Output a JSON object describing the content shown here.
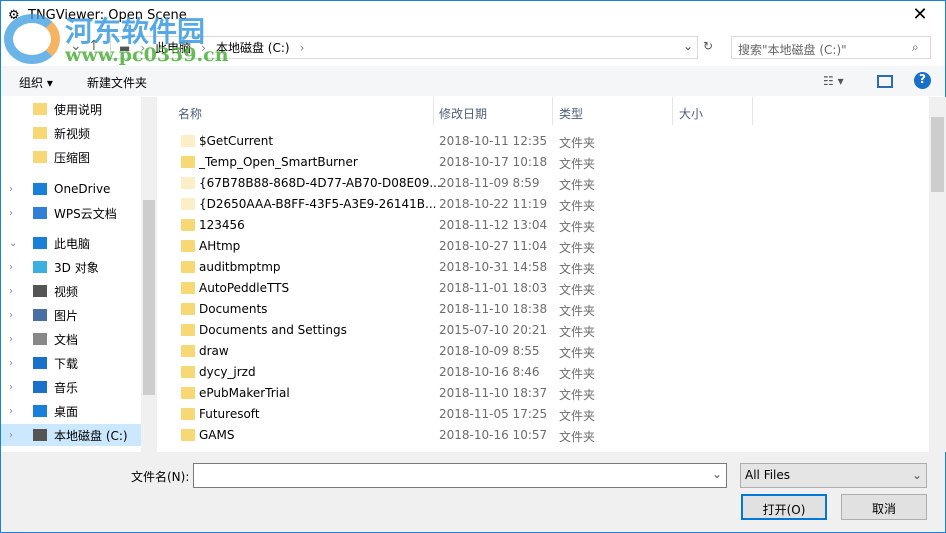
{
  "window": {
    "title": "TNGViewer: Open Scene",
    "close": "✕"
  },
  "watermark": {
    "name": "河东软件园",
    "url": "www.pc0359.cn"
  },
  "address": {
    "crumbs": [
      "此电脑",
      "›",
      "本地磁盘 (C:)",
      "›"
    ],
    "search_placeholder": "搜索\"本地磁盘 (C:)\""
  },
  "toolbar": {
    "organize": "组织 ▾",
    "new_folder": "新建文件夹",
    "help": "?"
  },
  "sidebar": [
    {
      "label": "使用说明",
      "chev": ""
    },
    {
      "label": "新视频",
      "chev": ""
    },
    {
      "label": "压缩图",
      "chev": ""
    },
    {
      "label": "OneDrive",
      "chev": "›"
    },
    {
      "label": "WPS云文档",
      "chev": "›"
    },
    {
      "label": "此电脑",
      "chev": "⌄"
    },
    {
      "label": "3D 对象",
      "chev": "›"
    },
    {
      "label": "视频",
      "chev": "›"
    },
    {
      "label": "图片",
      "chev": "›"
    },
    {
      "label": "文档",
      "chev": "›"
    },
    {
      "label": "下载",
      "chev": "›"
    },
    {
      "label": "音乐",
      "chev": "›"
    },
    {
      "label": "桌面",
      "chev": "›"
    },
    {
      "label": "本地磁盘 (C:)",
      "chev": "›"
    }
  ],
  "columns": [
    "名称",
    "修改日期",
    "类型",
    "大小"
  ],
  "files": [
    {
      "name": "$GetCurrent",
      "date": "2018-10-11 12:35",
      "type": "文件夹",
      "hidden": true
    },
    {
      "name": "_Temp_Open_SmartBurner",
      "date": "2018-10-17 10:18",
      "type": "文件夹"
    },
    {
      "name": "{67B78B88-868D-4D77-AB70-D08E09...",
      "date": "2018-11-09 8:59",
      "type": "文件夹",
      "hidden": true
    },
    {
      "name": "{D2650AAA-B8FF-43F5-A3E9-26141B...",
      "date": "2018-10-22 11:19",
      "type": "文件夹",
      "hidden": true
    },
    {
      "name": "123456",
      "date": "2018-11-12 13:04",
      "type": "文件夹"
    },
    {
      "name": "AHtmp",
      "date": "2018-10-27 11:04",
      "type": "文件夹"
    },
    {
      "name": "auditbmptmp",
      "date": "2018-10-31 14:58",
      "type": "文件夹"
    },
    {
      "name": "AutoPeddleTTS",
      "date": "2018-11-01 18:03",
      "type": "文件夹"
    },
    {
      "name": "Documents",
      "date": "2018-11-10 18:38",
      "type": "文件夹"
    },
    {
      "name": "Documents and Settings",
      "date": "2015-07-10 20:21",
      "type": "文件夹"
    },
    {
      "name": "draw",
      "date": "2018-10-09 8:55",
      "type": "文件夹"
    },
    {
      "name": "dycy_jrzd",
      "date": "2018-10-16 8:46",
      "type": "文件夹"
    },
    {
      "name": "ePubMakerTrial",
      "date": "2018-11-10 18:37",
      "type": "文件夹"
    },
    {
      "name": "Futuresoft",
      "date": "2018-11-05 17:25",
      "type": "文件夹"
    },
    {
      "name": "GAMS",
      "date": "2018-10-16 10:57",
      "type": "文件夹"
    }
  ],
  "bottom": {
    "filename_label": "文件名(N):",
    "filename_value": "",
    "filter": "All Files",
    "open": "打开(O)",
    "cancel": "取消"
  }
}
